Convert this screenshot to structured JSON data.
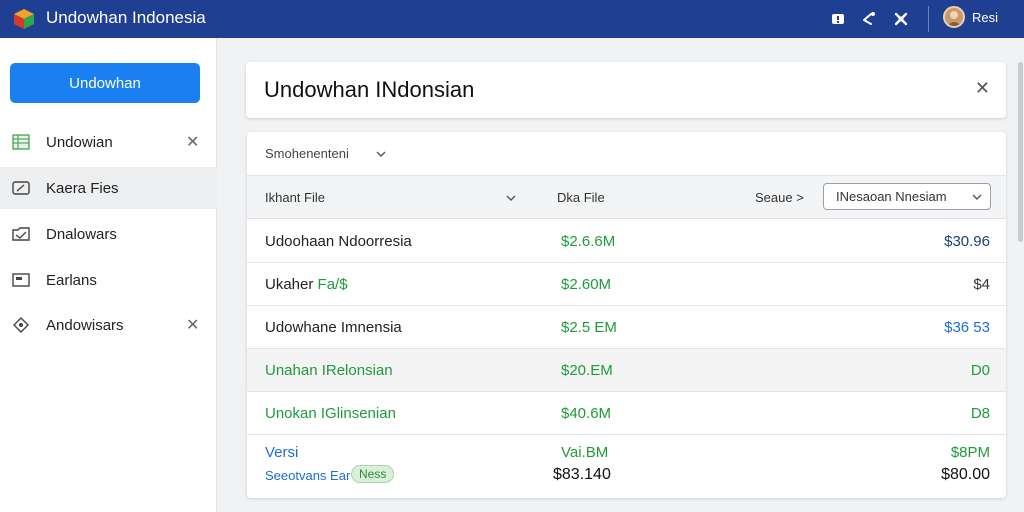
{
  "app": {
    "title": "Undowhan Indonesia",
    "user_name": "Resi"
  },
  "colors": {
    "topbar": "#1f3f93",
    "primary": "#1a7ff0",
    "green": "#1f9b3a",
    "blue": "#1a6fd0",
    "navy": "#1f3f7a"
  },
  "sidebar": {
    "primary_button": "Undowhan",
    "items": [
      {
        "label": "Undowian",
        "icon": "table-icon",
        "closable": true
      },
      {
        "label": "Kaera Fies",
        "icon": "gauge-icon",
        "closable": false
      },
      {
        "label": "Dnalowars",
        "icon": "folder-icon",
        "closable": false
      },
      {
        "label": "Earlans",
        "icon": "window-icon",
        "closable": false
      },
      {
        "label": "Andowisars",
        "icon": "tag-icon",
        "closable": true
      }
    ]
  },
  "header": {
    "title": "Undowhan INdonsian"
  },
  "table": {
    "filter_label": "Smohenenteni",
    "columns": {
      "name": "Ikhant File",
      "amount": "Dka File",
      "sort_label": "Seaue >",
      "select_value": "INesaoan    Nnesiam"
    },
    "rows": [
      {
        "name": "Udoohaan Ndoorresia",
        "name_suffix": "",
        "amount": "$2.6.6M",
        "right": "$30.96",
        "right_color": "#1f3f7a",
        "name_color": "#222",
        "shaded": false
      },
      {
        "name": "Ukaher ",
        "name_suffix": "Fa/$",
        "amount": "$2.60M",
        "right": "$4",
        "right_color": "#333",
        "name_color": "#222",
        "shaded": false
      },
      {
        "name": "Udowhane Imnensia",
        "name_suffix": "",
        "amount": "$2.5 EM",
        "right": "$36 53",
        "right_color": "#1a6fd0",
        "name_color": "#222",
        "shaded": false
      },
      {
        "name": "Unahan IRelonsian",
        "name_suffix": "",
        "amount": "$20.EM",
        "right": "D0",
        "right_color": "#1f9b3a",
        "name_color": "#1f9b3a",
        "shaded": true
      },
      {
        "name": "Unokan IGlinsenian",
        "name_suffix": "",
        "amount": "$40.6M",
        "right": "D8",
        "right_color": "#1f9b3a",
        "name_color": "#1f9b3a",
        "shaded": false
      }
    ],
    "footer": {
      "label": "Versi",
      "sub_label": "Seeotvans Ear",
      "chip": "Ness",
      "amount_top": "Vai.BM",
      "amount_bottom": "$83.140",
      "right_top": "$8PM",
      "right_bottom": "$80.00"
    }
  }
}
